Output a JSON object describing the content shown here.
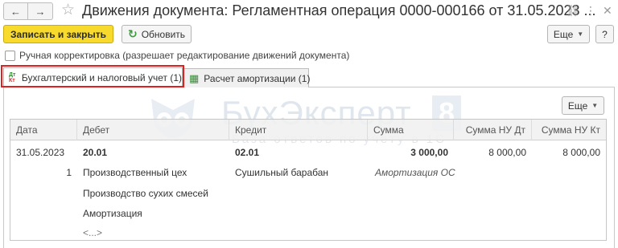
{
  "window": {
    "title": "Движения документа: Регламентная операция 0000-000166 от 31.05.2023 ...",
    "nav": {
      "back": "←",
      "forward": "→"
    },
    "icons": {
      "link": "⛓",
      "menu": "⋮",
      "close": "✕"
    }
  },
  "toolbar": {
    "save_close_label": "Записать и закрыть",
    "refresh_label": "Обновить",
    "more_label": "Еще",
    "help_label": "?"
  },
  "manual_correction_label": "Ручная корректировка (разрешает редактирование движений документа)",
  "tabs": [
    {
      "label": "Бухгалтерский и налоговый учет (1)",
      "icon_top": "Дт",
      "icon_bottom": "Кт"
    },
    {
      "label": "Расчет амортизации (1)"
    }
  ],
  "panel": {
    "more_label": "Еще"
  },
  "watermark": {
    "brand": "БухЭксперт",
    "number": "8",
    "subtitle": "База ответов по учету в 1С"
  },
  "table": {
    "columns": [
      "Дата",
      "Дебет",
      "Кредит",
      "Сумма",
      "Сумма НУ Дт",
      "Сумма НУ Кт"
    ],
    "row": {
      "date": "31.05.2023",
      "debit_account": "20.01",
      "credit_account": "02.01",
      "amount": "3 000,00",
      "nu_dt": "8 000,00",
      "nu_kt": "8 000,00",
      "line_no": "1",
      "debit_subconto": [
        "Производственный цех",
        "Производство сухих смесей",
        "Амортизация",
        "<...>"
      ],
      "credit_subconto": "Сушильный барабан",
      "content": "Амортизация ОС"
    }
  },
  "colors": {
    "primary_button": "#f7da2b",
    "highlight": "#e01f1f",
    "refresh_icon": "#3a9b3a"
  }
}
